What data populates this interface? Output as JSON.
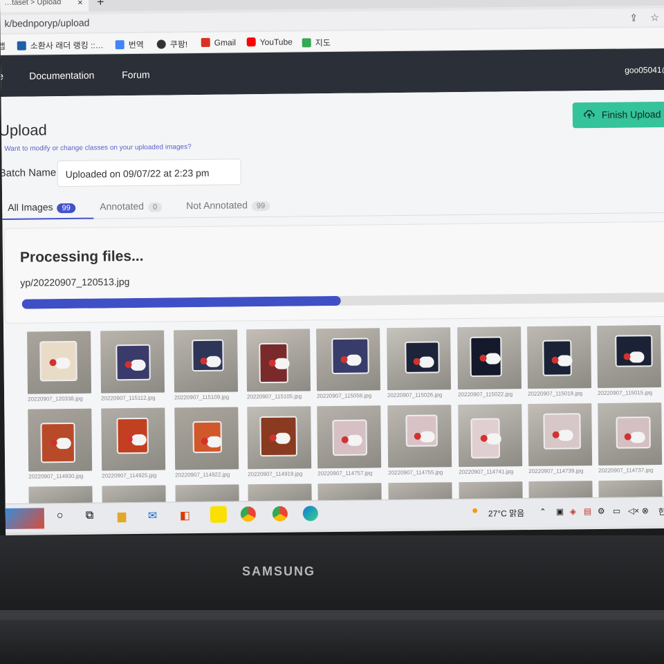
{
  "browser": {
    "tab_title": "…taset > Upload",
    "tab_close": "×",
    "tab_new": "+",
    "url": "k/bednporyp/upload",
    "bookmarks": [
      "앱",
      "소환사 래더 랭킹 ::…",
      "번역",
      "쿠팡!",
      "Gmail",
      "YouTube",
      "지도"
    ],
    "bookmark_colors": [
      "#c7c7c7",
      "#1f5ea8",
      "#4285f4",
      "#333333",
      "#d93025",
      "#ff0000",
      "#34a853"
    ]
  },
  "nav": {
    "partial": "e",
    "items": [
      "Documentation",
      "Forum"
    ],
    "user": "goo05041@"
  },
  "page": {
    "title": "Upload",
    "finish_label": "Finish Upload",
    "hint": "Want to modify or change classes on your uploaded images?",
    "batch_label": "Batch Name",
    "batch_value": "Uploaded on 09/07/22 at 2:23 pm",
    "accent": "#4352c9",
    "finish_color": "#34c39a"
  },
  "tabs": [
    {
      "label": "All Images",
      "count": "99"
    },
    {
      "label": "Annotated",
      "count": "0"
    },
    {
      "label": "Not Annotated",
      "count": "99"
    }
  ],
  "processing": {
    "heading": "Processing files...",
    "file": "yp/20220907_120513.jpg",
    "progress_fraction": 0.49
  },
  "thumbnails": [
    "20220907_120338.jpg",
    "20220907_115112.jpg",
    "20220907_115109.jpg",
    "20220907_115105.jpg",
    "20220907_115058.jpg",
    "20220907_115026.jpg",
    "20220907_115022.jpg",
    "20220907_115018.jpg",
    "20220907_115015.jpg",
    "20220907_114930.jpg",
    "20220907_114925.jpg",
    "20220907_114922.jpg",
    "20220907_114919.jpg",
    "20220907_114757.jpg",
    "20220907_114755.jpg",
    "20220907_114741.jpg",
    "20220907_114739.jpg",
    "20220907_114737.jpg"
  ],
  "taskbar": {
    "weather": "27°C 맑음",
    "ime": "한"
  },
  "device": {
    "brand": "SAMSUNG"
  }
}
